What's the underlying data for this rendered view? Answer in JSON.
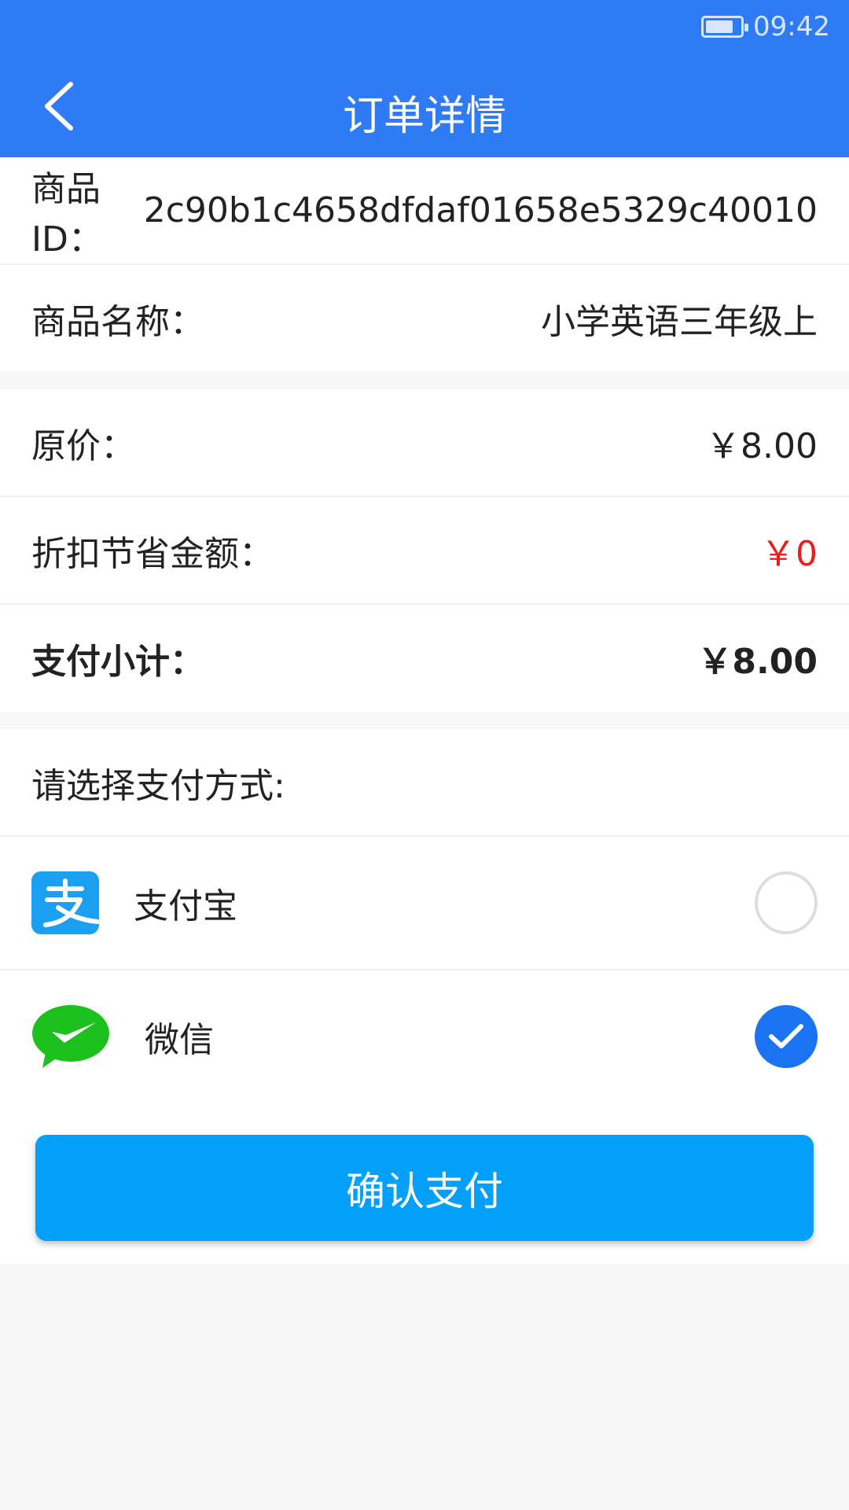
{
  "status_bar": {
    "time": "09:42",
    "battery_icon": "battery-icon"
  },
  "header": {
    "title": "订单详情",
    "back_icon": "chevron-left-icon"
  },
  "product": {
    "id_label": "商品ID：",
    "id_value": "2c90b1c4658dfdaf01658e5329c40010",
    "name_label": "商品名称：",
    "name_value": "小学英语三年级上"
  },
  "price": {
    "original_label": "原价：",
    "original_value": "￥8.00",
    "discount_label": "折扣节省金额：",
    "discount_value": "￥0",
    "subtotal_label": "支付小计：",
    "subtotal_value": "￥8.00"
  },
  "payment": {
    "prompt": "请选择支付方式:",
    "options": [
      {
        "label": "支付宝",
        "icon": "alipay-icon",
        "selected": false
      },
      {
        "label": "微信",
        "icon": "wechat-icon",
        "selected": true
      }
    ]
  },
  "confirm_button": "确认支付",
  "colors": {
    "header": "#2f7bf6",
    "discount": "#ee1c1c",
    "button": "#02a0fb",
    "radio_checked": "#1a73f0",
    "alipay": "#1b9ff0",
    "wechat": "#1dc11d"
  }
}
